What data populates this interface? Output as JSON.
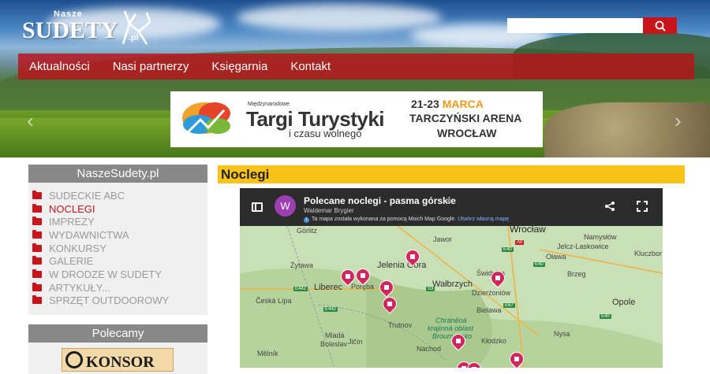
{
  "header": {
    "logo_small": "Nasze",
    "logo_main": "SUDETY",
    "logo_suffix": ".pl",
    "search_placeholder": ""
  },
  "nav": {
    "items": [
      "Aktualności",
      "Nasi partnerzy",
      "Księgarnia",
      "Kontakt"
    ]
  },
  "banner": {
    "mini": "Międzynarodowe",
    "title": "Targi Turystyki",
    "subtitle": "i czasu wolnego",
    "date_prefix": "21-23 ",
    "date_month": "MARCA",
    "arena": "TARCZYŃSKI ARENA",
    "city": "WROCŁAW"
  },
  "sidebar": {
    "title": "NaszeSudety.pl",
    "items": [
      {
        "label": "SUDECKIE ABC",
        "active": false
      },
      {
        "label": "NOCLEGI",
        "active": true
      },
      {
        "label": "IMPREZY",
        "active": false
      },
      {
        "label": "WYDAWNICTWA",
        "active": false
      },
      {
        "label": "KONKURSY",
        "active": false
      },
      {
        "label": "GALERIE",
        "active": false
      },
      {
        "label": "W DRODZE W SUDETY",
        "active": false
      },
      {
        "label": "ARTYKUŁY...",
        "active": false
      },
      {
        "label": "SPRZĘT OUTDOOROWY",
        "active": false
      }
    ],
    "polecamy_title": "Polecamy",
    "konsor_text": "KONSOR"
  },
  "main": {
    "title": "Noclegi"
  },
  "map": {
    "avatar_letter": "W",
    "title": "Polecane noclegi - pasma górskie",
    "author": "Waldemar Brygier",
    "info_text": "Ta mapa została wykonana za pomocą Moich Map Google.",
    "info_link": "Utwórz własną mapę",
    "labels": {
      "wroclaw": "Wrocław",
      "jawor": "Jawor",
      "namyslow": "Namysłów",
      "zgorzelec": "Görlitz",
      "jelenia": "Jelenia Góra",
      "jelcz": "Jelcz-Laskowice",
      "zytawa": "Żytawa",
      "kluczbork": "Kluczbor",
      "olawa": "Oława",
      "walbrzych": "Wałbrzych",
      "swidnica": "Świdnica",
      "brzeg": "Brzeg",
      "liberec": "Liberec",
      "poreba": "Poręba",
      "dzierzoniow": "Dzierżoniów",
      "ceska": "Česká Lípa",
      "opole": "Opole",
      "bielawa": "Bielawa",
      "trutnov": "Trutnov",
      "chranena": "Chráněná",
      "krajinna": "krajinná oblast",
      "broumovsko": "Broumovsko",
      "mlada": "Mladá",
      "boleslav": "Boleslav",
      "jicin": "Jičín",
      "nachod": "Náchod",
      "klodzko": "Kłodzko",
      "nysa": "Nysa",
      "melnik": "Mělník"
    }
  }
}
